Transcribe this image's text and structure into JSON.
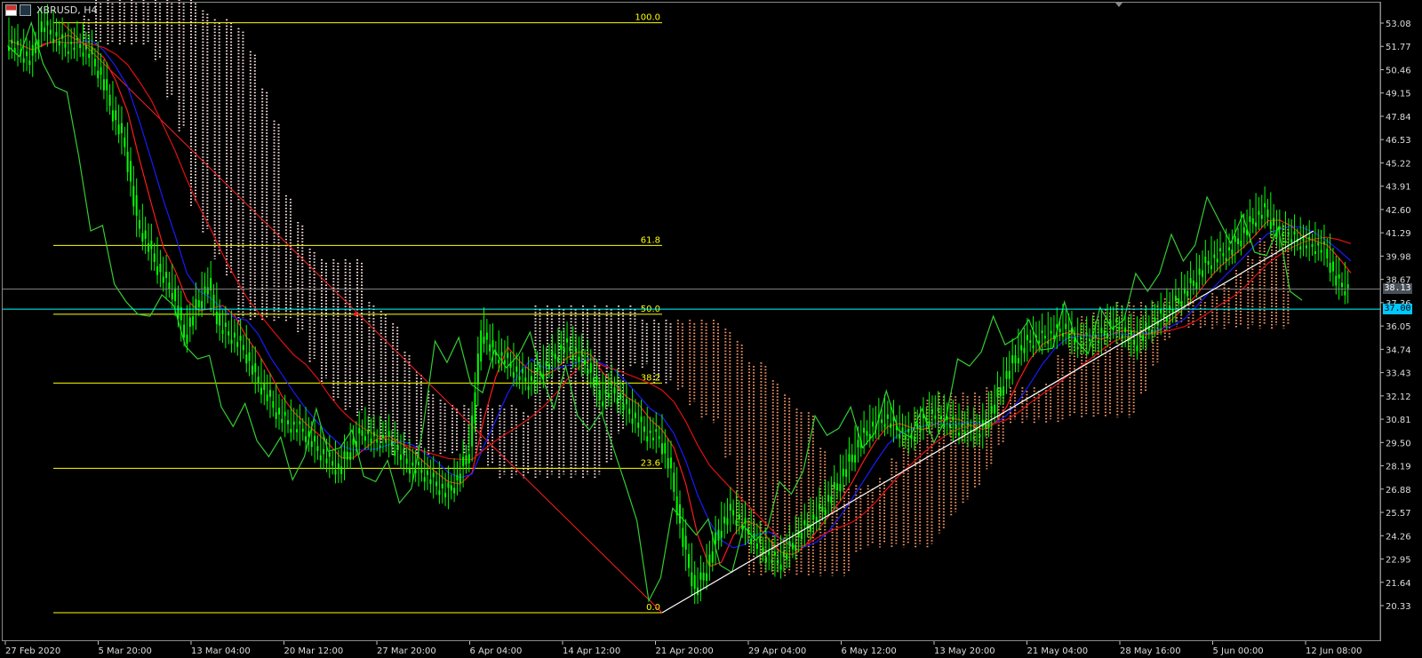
{
  "window": {
    "symbol": "XBRUSD, H4",
    "flags": [
      "us-flag-icon",
      "eu-flag-icon"
    ]
  },
  "colors": {
    "background": "#000000",
    "candle": "#00ff00",
    "ma_fast": "#ff0000",
    "ma_slow": "#0000ff",
    "fib": "#ffff00",
    "kumo_bear": "#ffe4e1",
    "kumo_bull": "#ff9966",
    "chikou": "#32cd32",
    "trendline": "#ffffff",
    "bid_line": "#808080",
    "alert_line": "#00ffff"
  },
  "price_axis": {
    "ticks": [
      "53.08",
      "51.77",
      "50.46",
      "49.15",
      "47.84",
      "46.53",
      "45.22",
      "43.91",
      "42.60",
      "41.29",
      "39.98",
      "38.67",
      "37.36",
      "36.05",
      "34.74",
      "33.43",
      "32.12",
      "30.81",
      "29.50",
      "28.19",
      "26.88",
      "25.57",
      "24.26",
      "22.95",
      "21.64",
      "20.33"
    ],
    "min": 20.33,
    "max": 53.08,
    "current_price": "38.13",
    "alert_price": "37.00"
  },
  "time_axis": {
    "labels": [
      "27 Feb 2020",
      "5 Mar 20:00",
      "13 Mar 04:00",
      "20 Mar 12:00",
      "27 Mar 20:00",
      "6 Apr 04:00",
      "14 Apr 12:00",
      "21 Apr 20:00",
      "29 Apr 04:00",
      "6 May 12:00",
      "13 May 20:00",
      "21 May 04:00",
      "28 May 16:00",
      "5 Jun 00:00",
      "12 Jun 08:00"
    ]
  },
  "fibonacci": {
    "levels": [
      {
        "label": "100.0",
        "price": 53.1
      },
      {
        "label": "61.8",
        "price": 40.58
      },
      {
        "label": "50.0",
        "price": 36.71
      },
      {
        "label": "38.2",
        "price": 32.84
      },
      {
        "label": "23.6",
        "price": 28.05
      },
      {
        "label": "0.0",
        "price": 20.33
      }
    ]
  },
  "chart_data": {
    "type": "line",
    "series": [
      {
        "values": [
          52.1,
          51.6,
          51.0,
          53.0,
          52.4,
          51.8,
          51.9,
          51.4,
          50.1,
          48.0,
          46.2,
          42.0,
          40.5,
          39.0,
          38.0,
          35.5,
          37.2,
          38.4,
          36.0,
          35.5,
          34.8,
          33.2,
          32.1,
          31.0,
          30.5,
          30.2,
          29.3,
          28.6,
          28.0,
          29.3,
          30.2,
          29.6,
          29.8,
          29.0,
          28.2,
          27.9,
          27.3,
          26.7,
          27.5,
          29.2,
          35.8,
          34.6,
          34.2,
          33.4,
          32.9,
          33.5,
          34.3,
          35.0,
          34.5,
          33.8,
          32.0,
          32.6,
          31.6,
          30.8,
          30.0,
          29.8,
          27.8,
          23.9,
          21.2,
          22.5,
          24.6,
          25.7,
          24.9,
          24.0,
          23.2,
          22.8,
          23.6,
          24.6,
          25.3,
          26.1,
          27.2,
          28.5,
          29.8,
          30.5,
          30.9,
          30.3,
          29.8,
          30.6,
          31.2,
          30.8,
          30.4,
          30.2,
          30.1,
          31.4,
          33.0,
          34.4,
          35.2,
          35.4,
          35.6,
          36.0,
          35.2,
          35.3,
          35.4,
          36.2,
          35.8,
          35.1,
          35.9,
          36.5,
          37.0,
          37.8,
          38.6,
          39.6,
          40.0,
          40.3,
          41.2,
          42.1,
          42.6,
          41.3,
          41.1,
          40.8,
          40.6,
          40.4,
          38.6,
          38.1
        ]
      }
    ],
    "ylim": [
      20.33,
      53.08
    ]
  }
}
